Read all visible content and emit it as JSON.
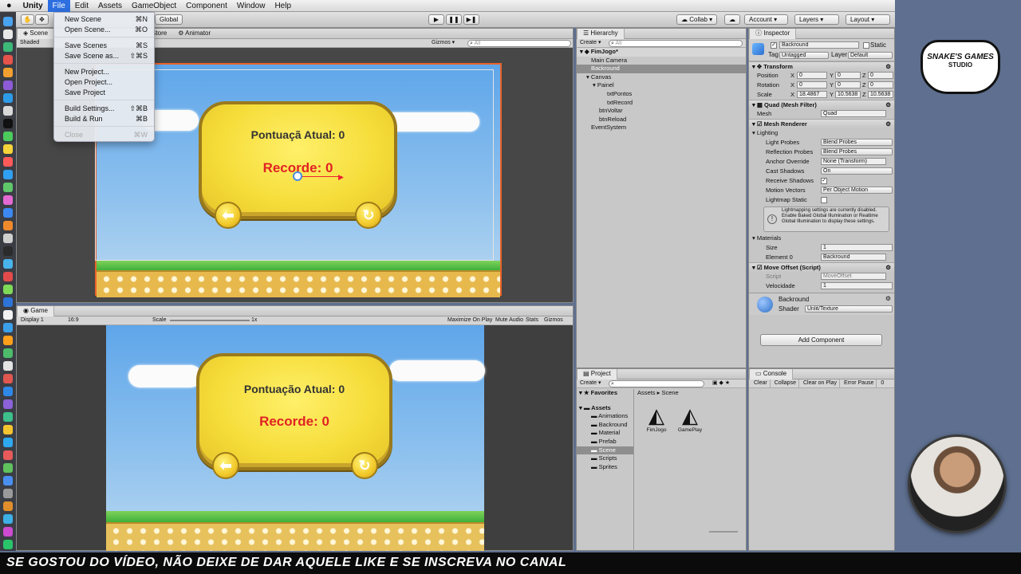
{
  "menubar": {
    "apple_icon": "apple-icon",
    "app": "Unity",
    "items": [
      "File",
      "Edit",
      "Assets",
      "GameObject",
      "Component",
      "Window",
      "Help"
    ]
  },
  "file_menu": {
    "items": [
      {
        "label": "New Scene",
        "shortcut": "⌘N"
      },
      {
        "label": "Open Scene...",
        "shortcut": "⌘O"
      },
      {
        "label": "Save Scenes",
        "shortcut": "⌘S"
      },
      {
        "label": "Save Scene as...",
        "shortcut": "⇧⌘S"
      },
      {
        "label": "New Project...",
        "shortcut": ""
      },
      {
        "label": "Open Project...",
        "shortcut": ""
      },
      {
        "label": "Save Project",
        "shortcut": ""
      },
      {
        "label": "Build Settings...",
        "shortcut": "⇧⌘B"
      },
      {
        "label": "Build & Run",
        "shortcut": "⌘B"
      },
      {
        "label": "Close",
        "shortcut": "⌘W"
      }
    ]
  },
  "toolbar": {
    "pivot_rotation": "Global",
    "collab": "Collab",
    "account": "Account",
    "layers": "Layers",
    "layout": "Layout"
  },
  "scene_panel": {
    "tabs": [
      "Scene",
      "Store",
      "Animator"
    ],
    "shading": "Shaded",
    "gizmos": "Gizmos",
    "search_placeholder": "All"
  },
  "game_ui": {
    "score_label": "Pontuação Atual: 0",
    "record_label": "Recorde: 0",
    "scene_score_label": "Pontuaçã Atual: 0"
  },
  "game_panel": {
    "tab": "Game",
    "display": "Display 1",
    "aspect": "16:9",
    "scale_label": "Scale",
    "scale_value": "1x",
    "maximize": "Maximize On Play",
    "mute": "Mute Audio",
    "stats": "Stats",
    "gizmos": "Gizmos"
  },
  "hierarchy": {
    "tab": "Hierarchy",
    "create": "Create",
    "search_placeholder": "All",
    "scene": "FimJogo*",
    "items": [
      {
        "label": "Main Camera",
        "depth": 1
      },
      {
        "label": "Backround",
        "depth": 1,
        "selected": true
      },
      {
        "label": "Canvas",
        "depth": 1
      },
      {
        "label": "Painel",
        "depth": 2
      },
      {
        "label": "txtPontos",
        "depth": 3
      },
      {
        "label": "txtRecord",
        "depth": 3
      },
      {
        "label": "btnVoltar",
        "depth": 2
      },
      {
        "label": "btnReload",
        "depth": 2
      },
      {
        "label": "EventSystem",
        "depth": 1
      }
    ]
  },
  "inspector": {
    "tab": "Inspector",
    "object_name": "Backround",
    "static_label": "Static",
    "tag_label": "Tag",
    "tag_value": "Untagged",
    "layer_label": "Layer",
    "layer_value": "Default",
    "transform": {
      "title": "Transform",
      "position": {
        "label": "Position",
        "x": "0",
        "y": "0",
        "z": "0"
      },
      "rotation": {
        "label": "Rotation",
        "x": "0",
        "y": "0",
        "z": "0"
      },
      "scale": {
        "label": "Scale",
        "x": "18.4867",
        "y": "10.5638",
        "z": "10.5638"
      }
    },
    "mesh_filter": {
      "title": "Quad (Mesh Filter)",
      "mesh_label": "Mesh",
      "mesh_value": "Quad"
    },
    "mesh_renderer": {
      "title": "Mesh Renderer",
      "lighting": "Lighting",
      "light_probes": {
        "label": "Light Probes",
        "value": "Blend Probes"
      },
      "reflection_probes": {
        "label": "Reflection Probes",
        "value": "Blend Probes"
      },
      "anchor_override": {
        "label": "Anchor Override",
        "value": "None (Transform)"
      },
      "cast_shadows": {
        "label": "Cast Shadows",
        "value": "On"
      },
      "receive_shadows": "Receive Shadows",
      "motion_vectors": {
        "label": "Motion Vectors",
        "value": "Per Object Motion"
      },
      "lightmap_static": "Lightmap Static",
      "info": "Lightmapping settings are currently disabled. Enable Baked Global Illumination or Realtime Global Illumination to display these settings.",
      "materials": "Materials",
      "size_label": "Size",
      "size_value": "1",
      "element_label": "Element 0",
      "element_value": "Backround"
    },
    "move_offset": {
      "title": "Move Offset (Script)",
      "script_label": "Script",
      "script_value": "MoveOffset",
      "velocity_label": "Velocidade",
      "velocity_value": "1"
    },
    "material": {
      "name": "Backround",
      "shader_label": "Shader",
      "shader_value": "Unlit/Texture"
    },
    "add_component": "Add Component"
  },
  "project": {
    "tab": "Project",
    "create": "Create",
    "favorites": "Favorites",
    "assets": "Assets",
    "folders": [
      "Animations",
      "Backround",
      "Material",
      "Prefab",
      "Scene",
      "Scripts",
      "Sprites"
    ],
    "selected_folder": "Scene",
    "breadcrumb": [
      "Assets",
      "Scene"
    ],
    "files": [
      "FimJogo",
      "GamePlay"
    ]
  },
  "console": {
    "tab": "Console",
    "buttons": [
      "Clear",
      "Collapse",
      "Clear on Play",
      "Error Pause"
    ],
    "count": "0"
  },
  "watermark": {
    "line1": "SNAKE'S GAMES",
    "line2": "STUDIO"
  },
  "subtitle": "SE GOSTOU DO VÍDEO, NÃO  DEIXE DE DAR AQUELE LIKE E SE INSCREVA NO CANAL"
}
